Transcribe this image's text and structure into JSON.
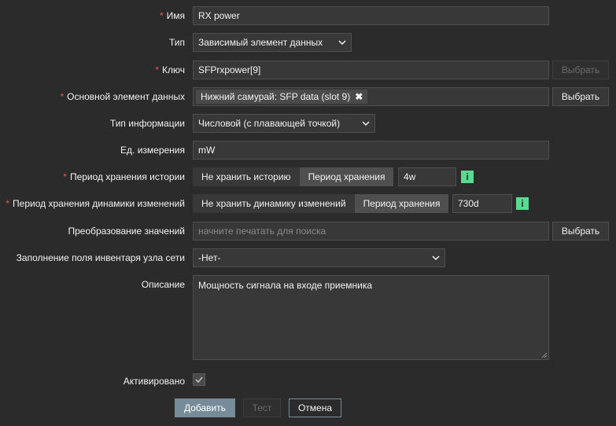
{
  "form": {
    "name": {
      "label": "Имя",
      "required": "*",
      "value": "RX power"
    },
    "type": {
      "label": "Тип",
      "value": "Зависимый элемент данных"
    },
    "key": {
      "label": "Ключ",
      "required": "*",
      "value": "SFPrxpower[9]",
      "button": "Выбрать"
    },
    "master_item": {
      "label": "Основной элемент данных",
      "required": "*",
      "chip": "Нижний самурай: SFP data (slot 9)",
      "chip_remove": "✖",
      "button": "Выбрать"
    },
    "info_type": {
      "label": "Тип информации",
      "value": "Числовой (с плавающей точкой)"
    },
    "units": {
      "label": "Ед. измерения",
      "value": "mW"
    },
    "history": {
      "label": "Период хранения истории",
      "required": "*",
      "opt_off": "Не хранить историю",
      "opt_on": "Период хранения",
      "value": "4w",
      "info": "i"
    },
    "trends": {
      "label": "Период хранения динамики изменений",
      "required": "*",
      "opt_off": "Не хранить динамику изменений",
      "opt_on": "Период хранения",
      "value": "730d",
      "info": "i"
    },
    "valuemap": {
      "label": "Преобразование значений",
      "placeholder": "начните печатать для поиска",
      "button": "Выбрать"
    },
    "inventory": {
      "label": "Заполнение поля инвентаря узла сети",
      "value": "-Нет-"
    },
    "description": {
      "label": "Описание",
      "value": "Мощность сигнала на входе приемника"
    },
    "enabled": {
      "label": "Активировано",
      "checked": true
    }
  },
  "actions": {
    "add": "Добавить",
    "test": "Тест",
    "cancel": "Отмена"
  },
  "colors": {
    "accent": "#768d99",
    "required": "#e45959",
    "info": "#59db8f",
    "background": "#2b2b2b"
  },
  "icons": {
    "dropdown": "chevron-down-icon",
    "info": "info-icon",
    "remove": "close-icon",
    "check": "checkmark-icon"
  }
}
